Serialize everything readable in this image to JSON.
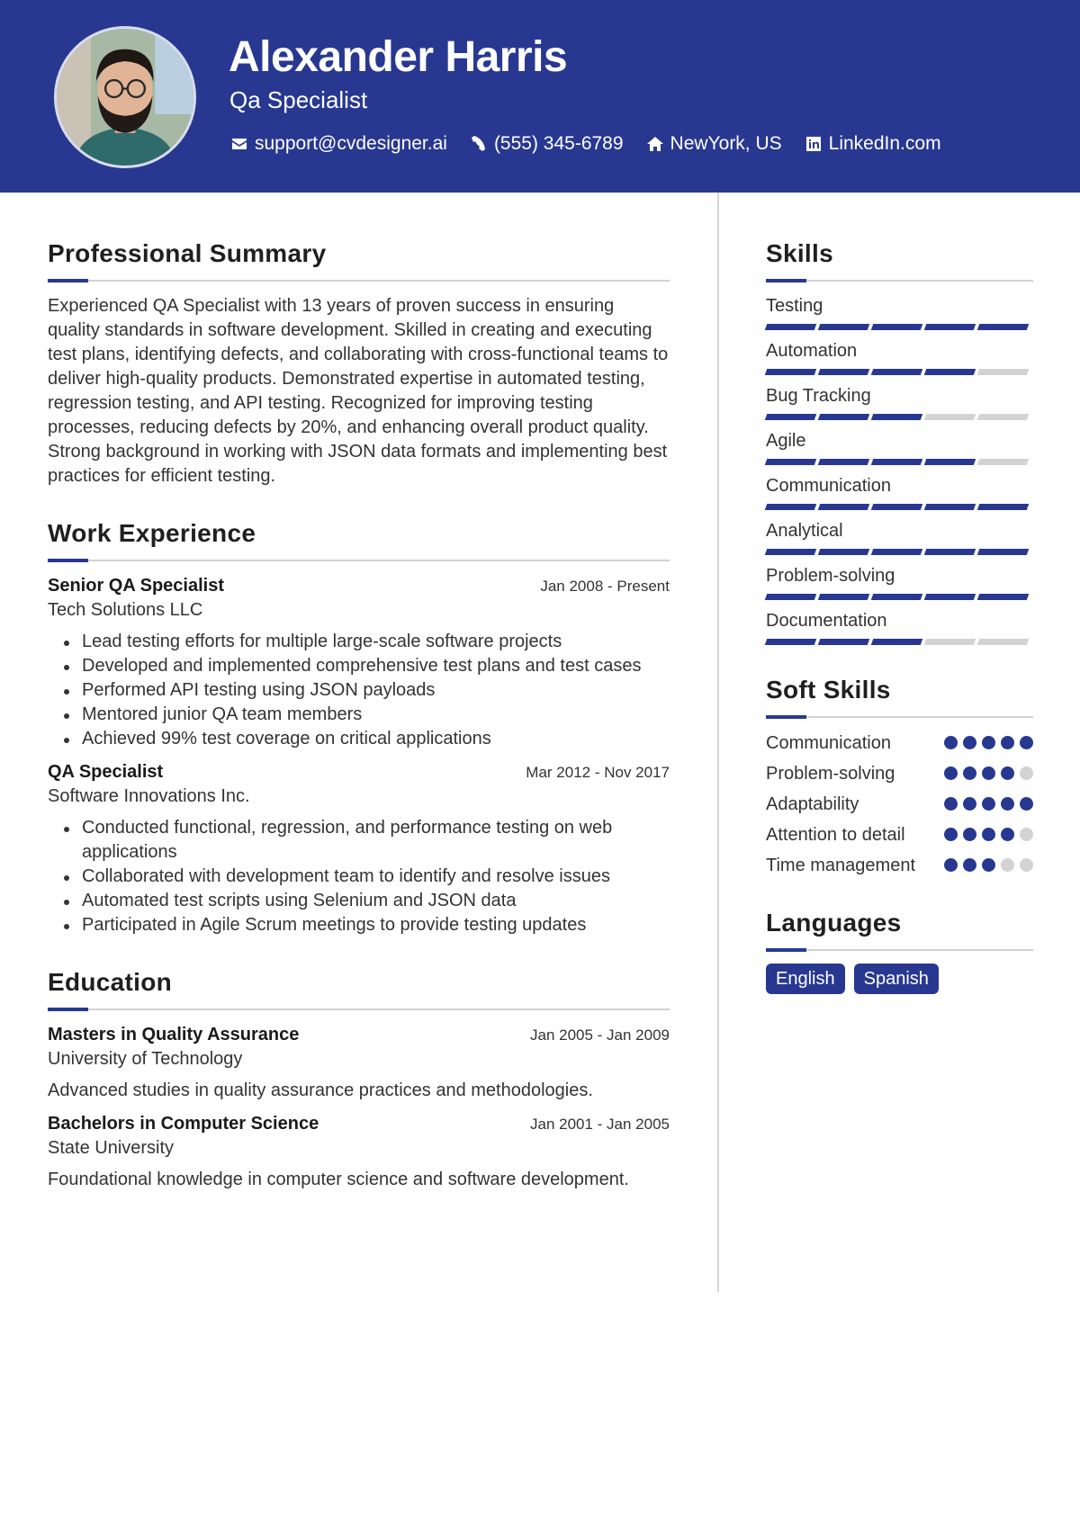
{
  "header": {
    "name": "Alexander Harris",
    "title": "Qa Specialist",
    "contacts": [
      {
        "icon": "envelope-icon",
        "text": "support@cvdesigner.ai"
      },
      {
        "icon": "phone-icon",
        "text": "(555) 345-6789"
      },
      {
        "icon": "home-icon",
        "text": "NewYork, US"
      },
      {
        "icon": "linkedin-icon",
        "text": "LinkedIn.com"
      }
    ]
  },
  "colors": {
    "accent": "#283891",
    "inactive": "#d3d3d3",
    "rule": "#d2d2d2"
  },
  "summary": {
    "heading": "Professional Summary",
    "text": "Experienced QA Specialist with 13 years of proven success in ensuring quality standards in software development. Skilled in creating and executing test plans, identifying defects, and collaborating with cross-functional teams to deliver high-quality products. Demonstrated expertise in automated testing, regression testing, and API testing. Recognized for improving testing processes, reducing defects by 20%, and enhancing overall product quality. Strong background in working with JSON data formats and implementing best practices for efficient testing."
  },
  "experience": {
    "heading": "Work Experience",
    "jobs": [
      {
        "title": "Senior QA Specialist",
        "date": "Jan 2008 - Present",
        "company": "Tech Solutions LLC",
        "bullets": [
          "Lead testing efforts for multiple large-scale software projects",
          "Developed and implemented comprehensive test plans and test cases",
          "Performed API testing using JSON payloads",
          "Mentored junior QA team members",
          "Achieved 99% test coverage on critical applications"
        ]
      },
      {
        "title": "QA Specialist",
        "date": "Mar 2012 - Nov 2017",
        "company": "Software Innovations Inc.",
        "bullets": [
          "Conducted functional, regression, and performance testing on web applications",
          "Collaborated with development team to identify and resolve issues",
          "Automated test scripts using Selenium and JSON data",
          "Participated in Agile Scrum meetings to provide testing updates"
        ]
      }
    ]
  },
  "education": {
    "heading": "Education",
    "items": [
      {
        "degree": "Masters in Quality Assurance",
        "date": "Jan 2005 - Jan 2009",
        "school": "University of Technology",
        "desc": "Advanced studies in quality assurance practices and methodologies."
      },
      {
        "degree": "Bachelors in Computer Science",
        "date": "Jan 2001 - Jan 2005",
        "school": "State University",
        "desc": "Foundational knowledge in computer science and software development."
      }
    ]
  },
  "skills": {
    "heading": "Skills",
    "max": 5,
    "items": [
      {
        "name": "Testing",
        "level": 5
      },
      {
        "name": "Automation",
        "level": 4
      },
      {
        "name": "Bug Tracking",
        "level": 3
      },
      {
        "name": "Agile",
        "level": 4
      },
      {
        "name": "Communication",
        "level": 5
      },
      {
        "name": "Analytical",
        "level": 5
      },
      {
        "name": "Problem-solving",
        "level": 5
      },
      {
        "name": "Documentation",
        "level": 3
      }
    ]
  },
  "soft_skills": {
    "heading": "Soft Skills",
    "max": 5,
    "items": [
      {
        "name": "Communication",
        "level": 5
      },
      {
        "name": "Problem-solving",
        "level": 4
      },
      {
        "name": "Adaptability",
        "level": 5
      },
      {
        "name": "Attention to detail",
        "level": 4
      },
      {
        "name": "Time management",
        "level": 3
      }
    ]
  },
  "languages": {
    "heading": "Languages",
    "items": [
      "English",
      "Spanish"
    ]
  }
}
